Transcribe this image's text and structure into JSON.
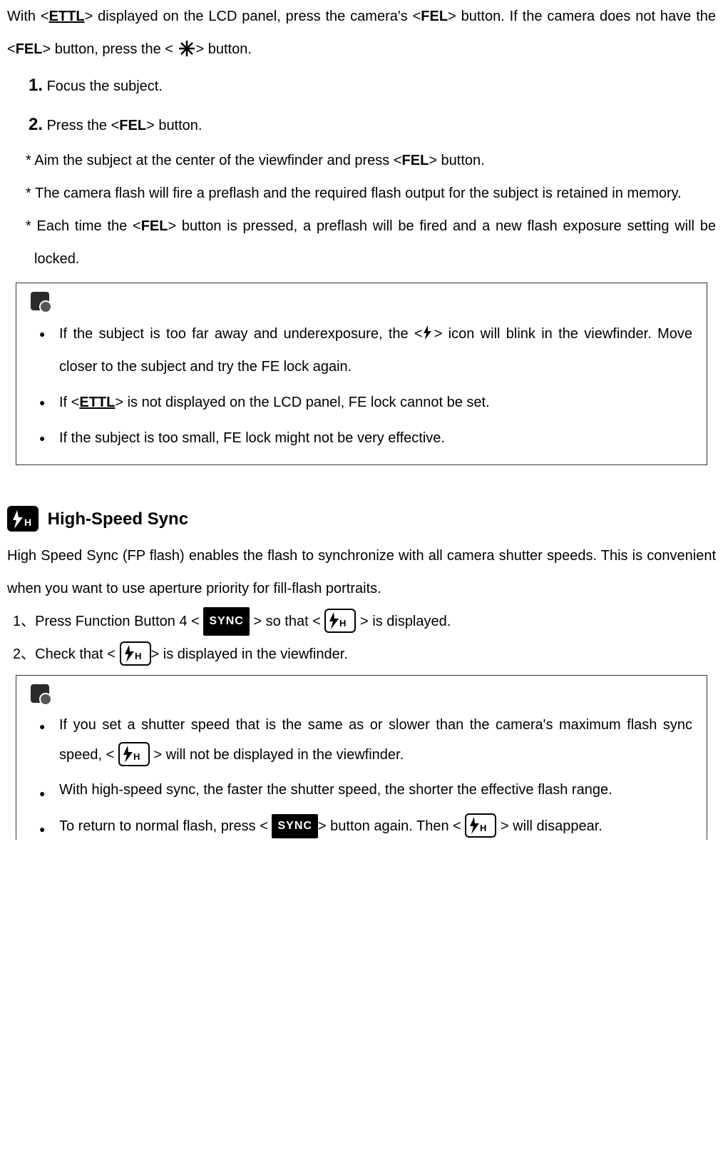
{
  "intro": {
    "part1": "With <",
    "ettl": "ETTL",
    "part2": "> displayed on the LCD panel, press the camera's <",
    "fel": "FEL",
    "part3": "> button. If the camera does not have the <",
    "part4": "> button, press the <",
    "part5": "> button."
  },
  "steps": {
    "s1_num": "1.",
    "s1_text": " Focus the subject.",
    "s2_num": "2.",
    "s2_text_a": " Press the <",
    "s2_fel": "FEL",
    "s2_text_b": "> button.",
    "sub1_a": "* Aim the subject at the center of the viewfinder and press <",
    "sub1_fel": "FEL",
    "sub1_b": "> button.",
    "sub2": "* The camera flash will fire a preflash and the required flash output for the subject is retained in memory.",
    "sub3_a": "* Each time the <",
    "sub3_fel": "FEL",
    "sub3_b": "> button is pressed, a preflash will be fired and a new flash exposure setting will be locked."
  },
  "note1": {
    "b1_a": "If the subject is too far away and underexposure, the <",
    "b1_b": "> icon will blink in the viewfinder. Move closer to the subject and try the FE lock again.",
    "b2_a": "If <",
    "b2_ettl": "ETTL",
    "b2_b": "> is not displayed on the LCD panel, FE lock cannot be set.",
    "b3": "If the subject is too small, FE lock might not be very effective."
  },
  "hss": {
    "title": "High-Speed Sync",
    "desc": "High Speed Sync (FP flash) enables the flash to synchronize with all camera shutter speeds. This is convenient when you want to use aperture priority for fill-flash portraits.",
    "l1_a": "1、Press Function Button 4 < ",
    "sync": "SYNC",
    "l1_b": " > so that < ",
    "l1_c": " > is displayed.",
    "l2_a": "2、Check that < ",
    "l2_b": "> is displayed in the viewfinder."
  },
  "note2": {
    "b1_a": "If you set a shutter speed that is the same as or slower than the camera's maximum flash sync speed, < ",
    "b1_b": " > will not be displayed in the viewfinder.",
    "b2": "With high-speed sync, the faster the shutter speed, the shorter the effective flash range.",
    "b3_a": "To return to normal flash, press < ",
    "b3_b": "> button again. Then < ",
    "b3_c": " > will disappear."
  }
}
